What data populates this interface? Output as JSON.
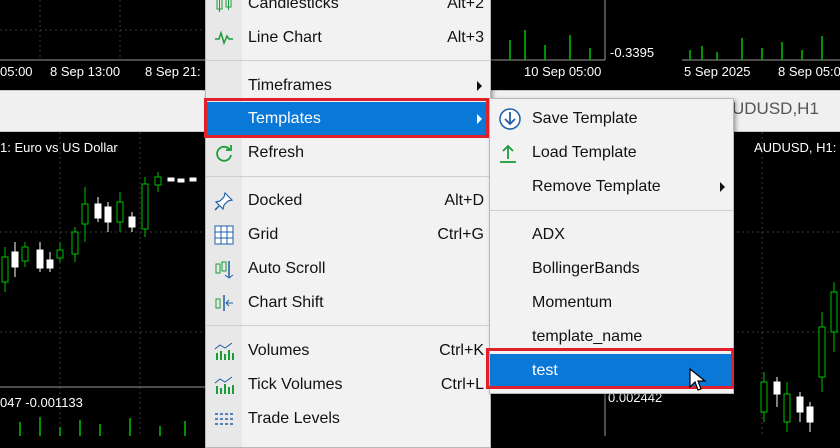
{
  "charts": {
    "top_left": {
      "axis_labels": [
        "05:00",
        "8 Sep 13:00",
        "8 Sep 21:"
      ]
    },
    "top_mid": {
      "value_label": "-0.3395",
      "axis_label": "10 Sep 05:00"
    },
    "top_right": {
      "axis_labels": [
        "5 Sep 2025",
        "8 Sep 05:00"
      ]
    },
    "left": {
      "title": "1:  Euro vs US Dollar",
      "value_label": "047 -0.001133"
    },
    "mid": {
      "value_label": "0.002442"
    },
    "right": {
      "title": "AUDUSD, H1:"
    }
  },
  "window_strip": {
    "title": "UDUSD,H1"
  },
  "context_menu": {
    "items": [
      {
        "label": "Candlesticks",
        "shortcut": "Alt+2",
        "icon": "candlestick-icon"
      },
      {
        "label": "Line Chart",
        "shortcut": "Alt+3",
        "icon": "line-chart-icon"
      },
      {
        "label": "Timeframes",
        "submenu": true
      },
      {
        "label": "Templates",
        "submenu": true,
        "highlighted": true
      },
      {
        "label": "Refresh",
        "icon": "refresh-icon"
      },
      {
        "label": "Docked",
        "shortcut": "Alt+D",
        "icon": "pin-icon"
      },
      {
        "label": "Grid",
        "shortcut": "Ctrl+G",
        "icon": "grid-icon"
      },
      {
        "label": "Auto Scroll",
        "icon": "auto-scroll-icon"
      },
      {
        "label": "Chart Shift",
        "icon": "chart-shift-icon"
      },
      {
        "label": "Volumes",
        "shortcut": "Ctrl+K",
        "icon": "volumes-icon"
      },
      {
        "label": "Tick Volumes",
        "shortcut": "Ctrl+L",
        "icon": "tick-volumes-icon"
      },
      {
        "label": "Trade Levels",
        "icon": "trade-levels-icon"
      }
    ]
  },
  "templates_submenu": {
    "items": [
      {
        "label": "Save Template",
        "icon": "save-template-icon"
      },
      {
        "label": "Load Template",
        "icon": "load-template-icon"
      },
      {
        "label": "Remove Template",
        "submenu": true
      },
      {
        "label": "ADX"
      },
      {
        "label": "BollingerBands"
      },
      {
        "label": "Momentum"
      },
      {
        "label": "template_name"
      },
      {
        "label": "test",
        "highlighted": true
      }
    ]
  },
  "colors": {
    "highlight": "#0a78d7",
    "annotation_box": "#e0202a",
    "bull_candle": "#00c000",
    "bear_candle": "#ffffff"
  }
}
